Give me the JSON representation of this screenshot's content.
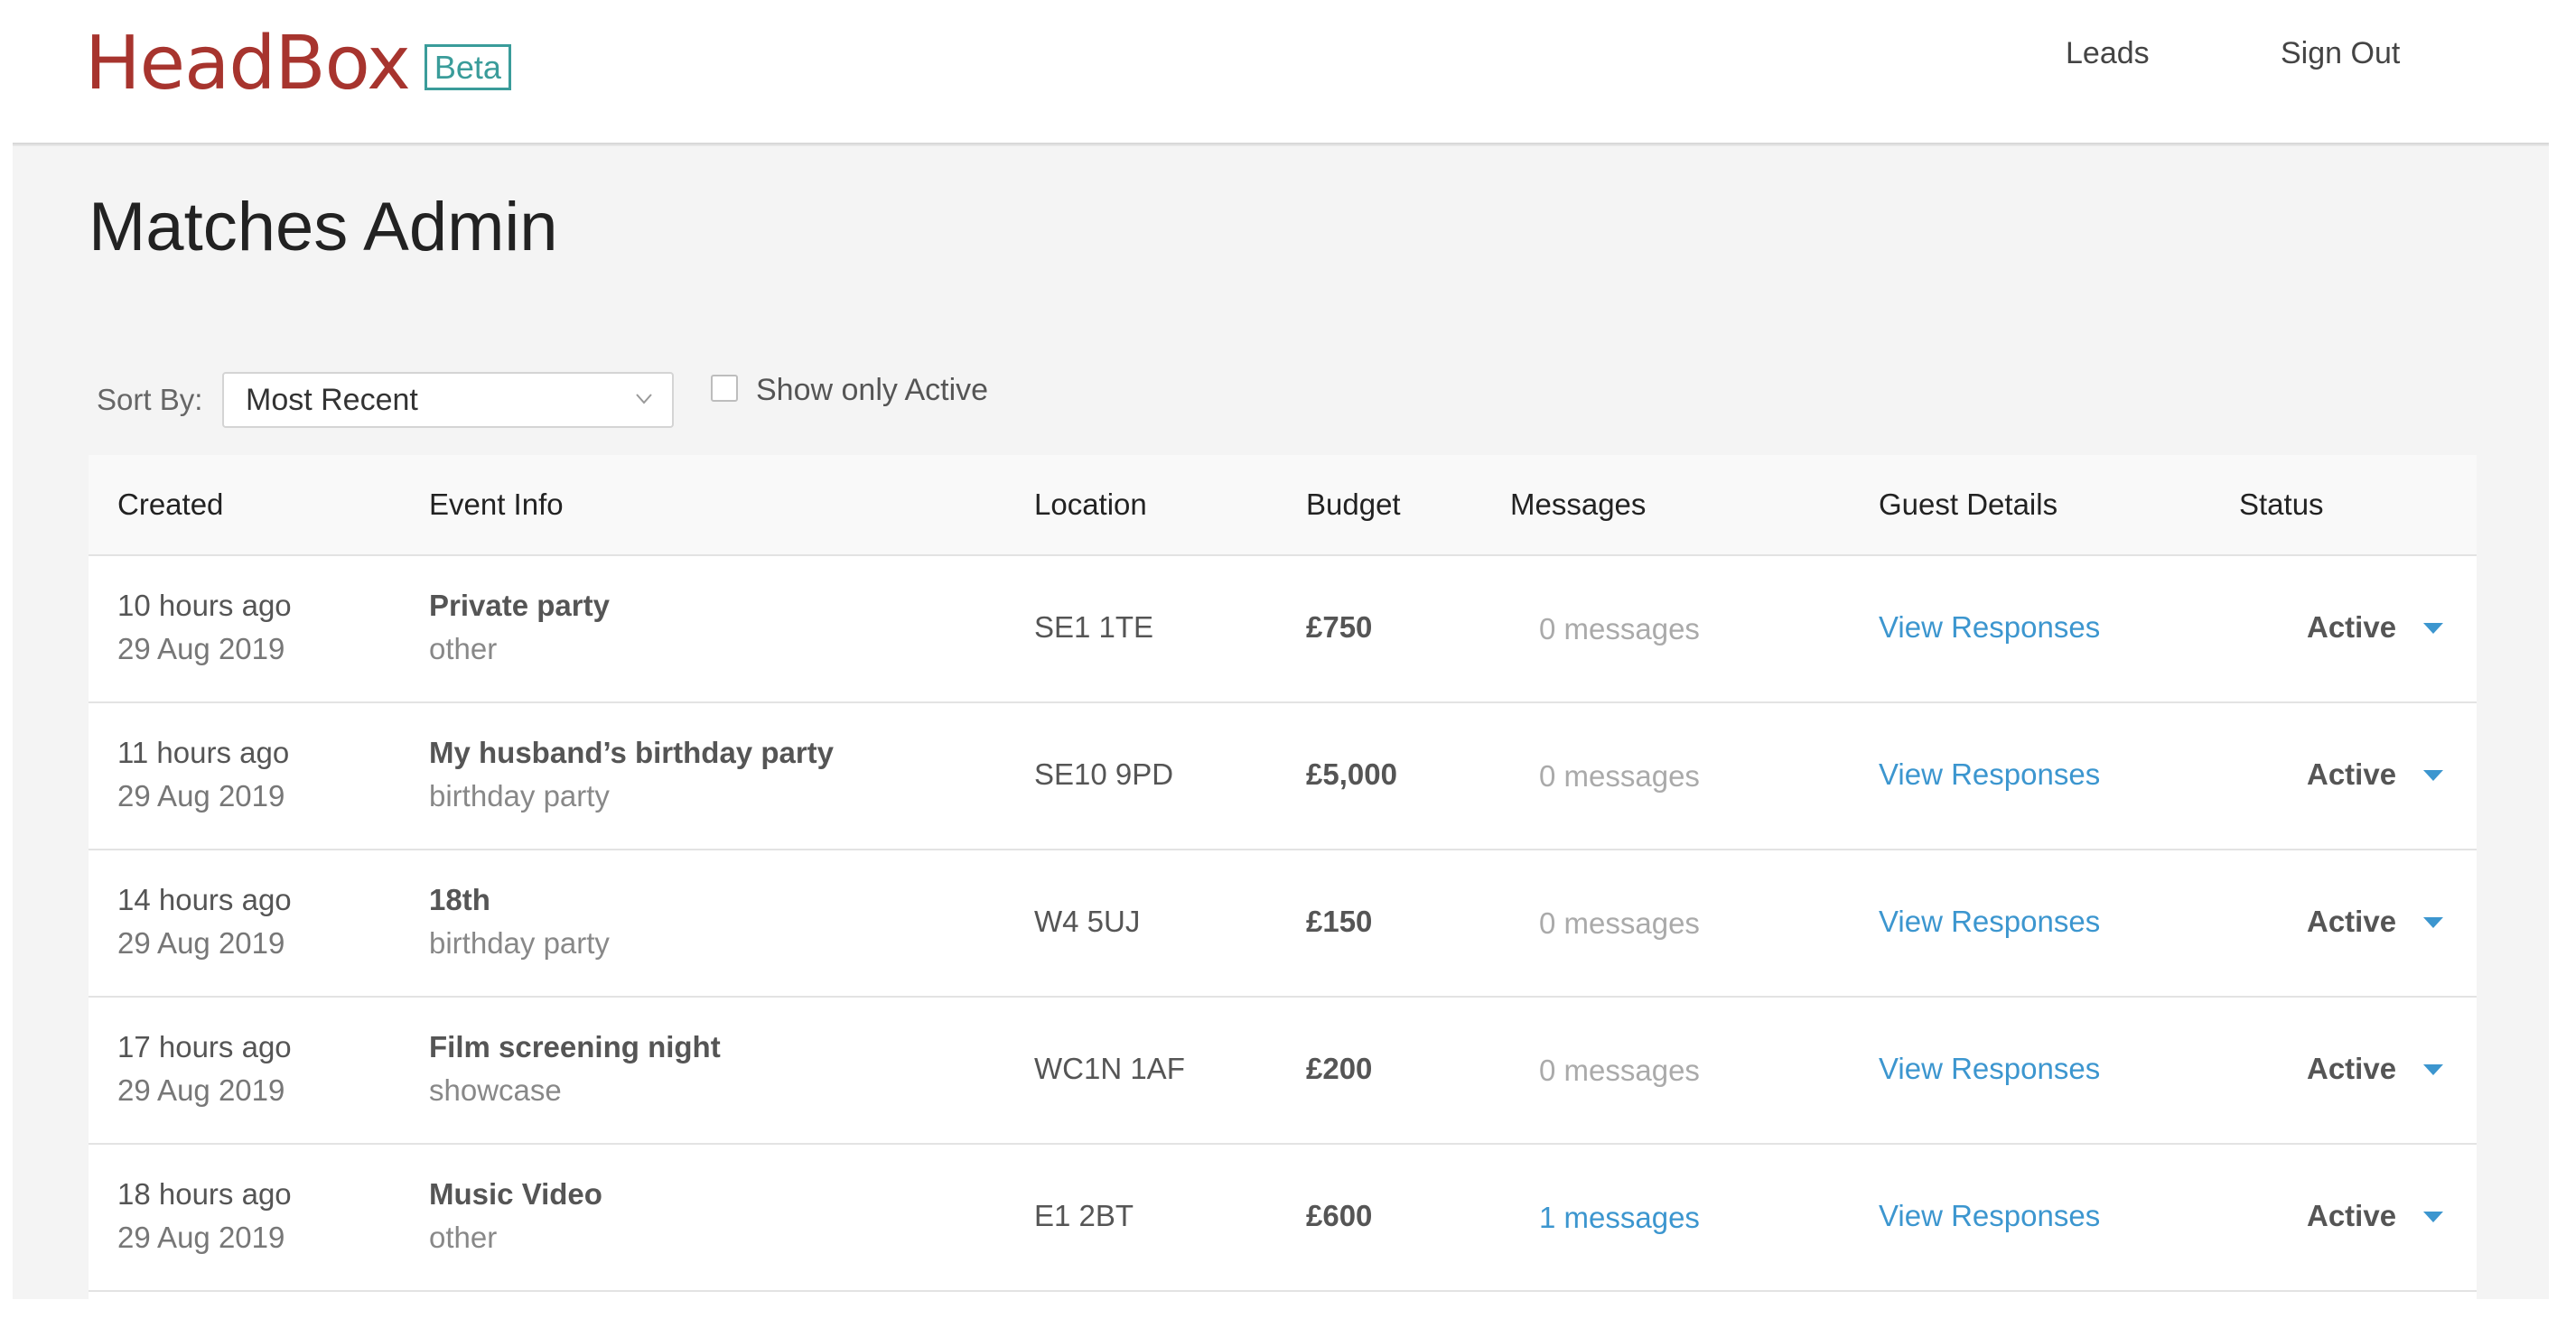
{
  "header": {
    "logo_text": "HeadBox",
    "logo_badge": "Beta",
    "nav": {
      "leads": "Leads",
      "sign_out": "Sign Out"
    }
  },
  "page": {
    "title": "Matches Admin"
  },
  "controls": {
    "sort_label": "Sort By:",
    "sort_value": "Most Recent",
    "show_only_active_label": "Show only Active",
    "show_only_active_checked": false
  },
  "table": {
    "columns": [
      "Created",
      "Event Info",
      "Location",
      "Budget",
      "Messages",
      "Guest Details",
      "Status"
    ],
    "rows": [
      {
        "created_relative": "10 hours ago",
        "created_date": "29 Aug 2019",
        "event_title": "Private party",
        "event_type": "other",
        "location": "SE1 1TE",
        "budget": "£750",
        "messages": "0 messages",
        "guest_details": "View Responses",
        "status": "Active"
      },
      {
        "created_relative": "11 hours ago",
        "created_date": "29 Aug 2019",
        "event_title": "My husband’s birthday party",
        "event_type": "birthday party",
        "location": "SE10 9PD",
        "budget": "£5,000",
        "messages": "0 messages",
        "guest_details": "View Responses",
        "status": "Active"
      },
      {
        "created_relative": "14 hours ago",
        "created_date": "29 Aug 2019",
        "event_title": "18th",
        "event_type": "birthday party",
        "location": "W4 5UJ",
        "budget": "£150",
        "messages": "0 messages",
        "guest_details": "View Responses",
        "status": "Active"
      },
      {
        "created_relative": "17 hours ago",
        "created_date": "29 Aug 2019",
        "event_title": "Film screening night",
        "event_type": "showcase",
        "location": "WC1N 1AF",
        "budget": "£200",
        "messages": "0 messages",
        "guest_details": "View Responses",
        "status": "Active"
      },
      {
        "created_relative": "18 hours ago",
        "created_date": "29 Aug 2019",
        "event_title": "Music Video",
        "event_type": "other",
        "location": "E1 2BT",
        "budget": "£600",
        "messages": "1 messages",
        "guest_details": "View Responses",
        "status": "Active"
      }
    ]
  },
  "colors": {
    "brand": "#a7342e",
    "beta_badge": "#3a9c9a",
    "link": "#3c96cf",
    "page_background": "#f4f4f4"
  },
  "icons": {
    "sort_chevron": "chevron-down-icon",
    "status_caret": "caret-down-icon"
  }
}
